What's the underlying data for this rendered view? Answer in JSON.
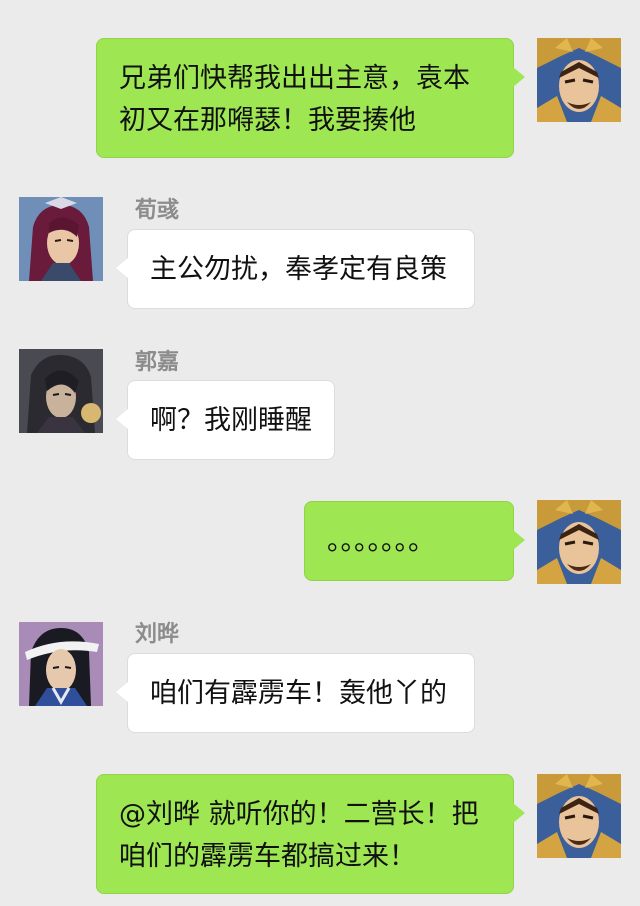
{
  "colors": {
    "background": "#ebebeb",
    "outgoing_bubble": "#9ee652",
    "incoming_bubble": "#ffffff",
    "name_text": "#8c8c8c"
  },
  "messages": [
    {
      "side": "outgoing",
      "avatar_icon": "cao-cao-avatar",
      "text": "兄弟们快帮我出出主意，袁本初又在那嘚瑟！我要揍他"
    },
    {
      "side": "incoming",
      "sender": "荀彧",
      "avatar_icon": "xun-yu-avatar",
      "text": "主公勿扰，奉孝定有良策"
    },
    {
      "side": "incoming",
      "sender": "郭嘉",
      "avatar_icon": "guo-jia-avatar",
      "text": "啊？我刚睡醒"
    },
    {
      "side": "outgoing",
      "avatar_icon": "cao-cao-avatar",
      "text": "。。。。。。。"
    },
    {
      "side": "incoming",
      "sender": "刘晔",
      "avatar_icon": "liu-ye-avatar",
      "text": "咱们有霹雳车！轰他丫的"
    },
    {
      "side": "outgoing",
      "avatar_icon": "cao-cao-avatar",
      "text": "@刘晔 就听你的！二营长！把咱们的霹雳车都搞过来！"
    }
  ]
}
